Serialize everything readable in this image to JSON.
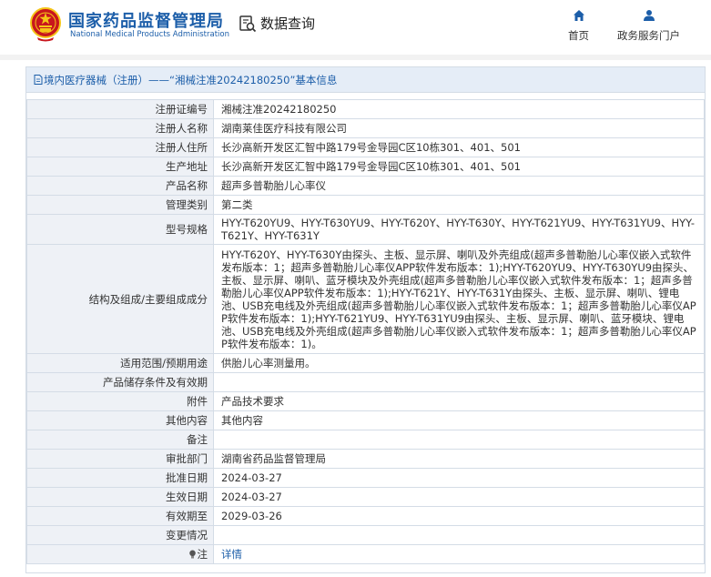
{
  "header": {
    "title_cn": "国家药品监督管理局",
    "title_en": "National Medical Products Administration",
    "query_label": "数据查询",
    "nav": [
      {
        "label": "首页",
        "icon": "home-icon"
      },
      {
        "label": "政务服务门户",
        "icon": "user-icon"
      }
    ]
  },
  "panel": {
    "title": "境内医疗器械（注册）——“湘械注准20242180250”基本信息"
  },
  "fields": [
    {
      "label": "注册证编号",
      "value": "湘械注准20242180250"
    },
    {
      "label": "注册人名称",
      "value": "湖南莱佳医疗科技有限公司"
    },
    {
      "label": "注册人住所",
      "value": "长沙高新开发区汇智中路179号金导园C区10栋301、401、501"
    },
    {
      "label": "生产地址",
      "value": "长沙高新开发区汇智中路179号金导园C区10栋301、401、501"
    },
    {
      "label": "产品名称",
      "value": "超声多普勒胎儿心率仪"
    },
    {
      "label": "管理类别",
      "value": "第二类"
    },
    {
      "label": "型号规格",
      "value": "HYY-T620YU9、HYY-T630YU9、HYY-T620Y、HYY-T630Y、HYY-T621YU9、HYY-T631YU9、HYY-T621Y、HYY-T631Y"
    },
    {
      "label": "结构及组成/主要组成成分",
      "value": "HYY-T620Y、HYY-T630Y由探头、主板、显示屏、喇叭及外壳组成(超声多普勒胎儿心率仪嵌入式软件发布版本：1；超声多普勒胎儿心率仪APP软件发布版本：1);HYY-T620YU9、HYY-T630YU9由探头、主板、显示屏、喇叭、蓝牙模块及外壳组成(超声多普勒胎儿心率仪嵌入式软件发布版本：1；超声多普勒胎儿心率仪APP软件发布版本：1);HYY-T621Y、HYY-T631Y由探头、主板、显示屏、喇叭、锂电池、USB充电线及外壳组成(超声多普勒胎儿心率仪嵌入式软件发布版本：1；超声多普勒胎儿心率仪APP软件发布版本：1);HYY-T621YU9、HYY-T631YU9由探头、主板、显示屏、喇叭、蓝牙模块、锂电池、USB充电线及外壳组成(超声多普勒胎儿心率仪嵌入式软件发布版本：1；超声多普勒胎儿心率仪APP软件发布版本：1)。"
    },
    {
      "label": "适用范围/预期用途",
      "value": "供胎儿心率测量用。"
    },
    {
      "label": "产品储存条件及有效期",
      "value": ""
    },
    {
      "label": "附件",
      "value": "产品技术要求"
    },
    {
      "label": "其他内容",
      "value": "其他内容"
    },
    {
      "label": "备注",
      "value": ""
    },
    {
      "label": "审批部门",
      "value": "湖南省药品监督管理局"
    },
    {
      "label": "批准日期",
      "value": "2024-03-27"
    },
    {
      "label": "生效日期",
      "value": "2024-03-27"
    },
    {
      "label": "有效期至",
      "value": "2029-03-26"
    },
    {
      "label": "变更情况",
      "value": ""
    },
    {
      "label": "注",
      "value": "详情"
    }
  ],
  "colors": {
    "brand_blue": "#1c5ea9",
    "label_bg": "#eef1f6",
    "title_bg": "#e5edf7",
    "border": "#d4dce6",
    "emblem_red": "#c8161d",
    "emblem_gold": "#f5c518"
  }
}
